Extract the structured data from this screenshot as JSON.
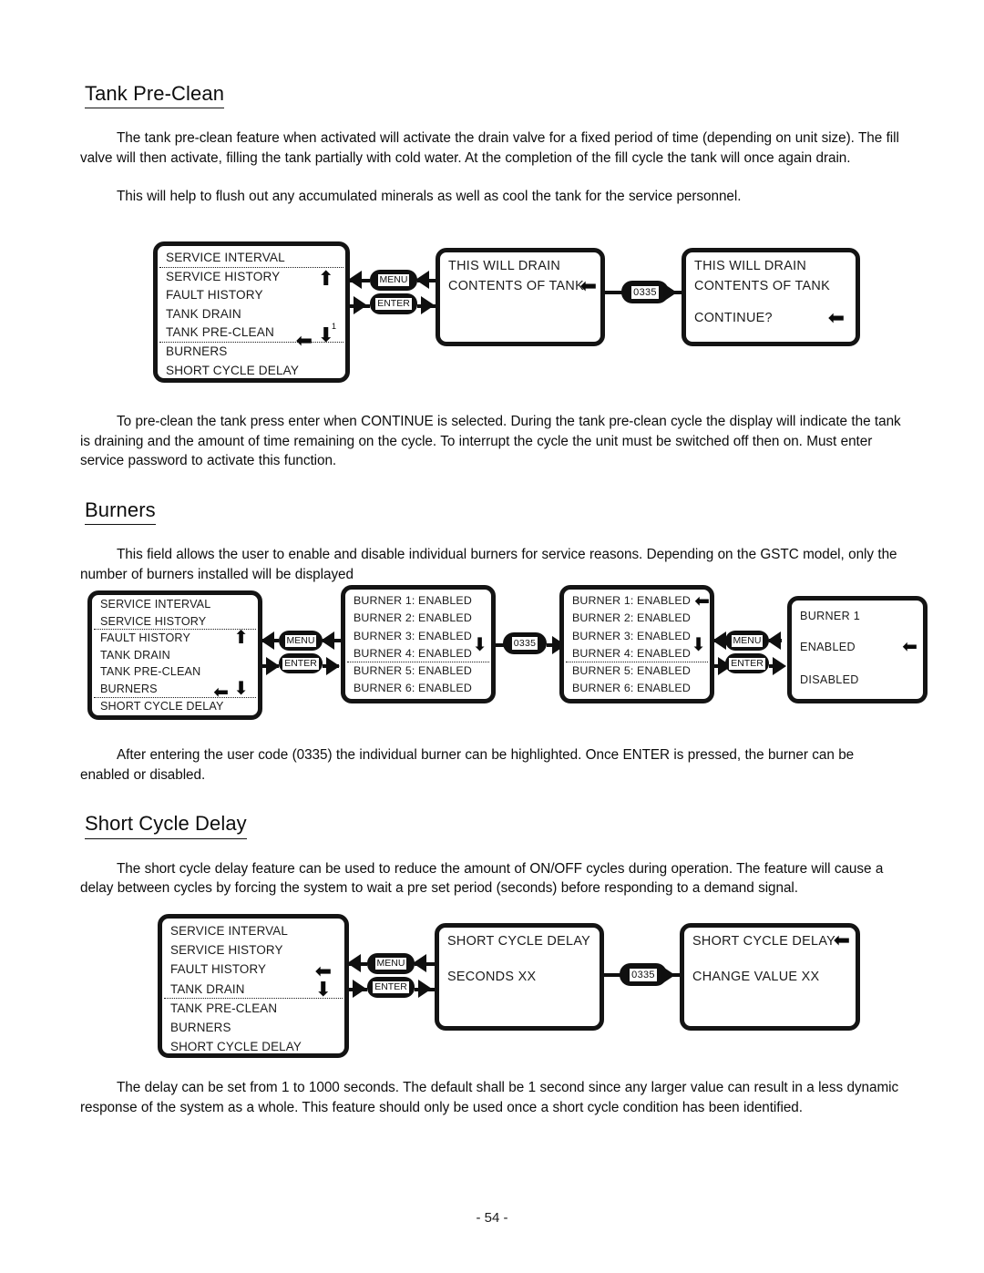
{
  "page": {
    "footer": "- 54 -"
  },
  "sections": [
    {
      "heading": "Tank Pre-Clean",
      "paragraphs": [
        "The tank pre-clean feature when activated will activate the drain valve for a fixed period of time (depending on unit size). The fill valve will then activate, filling the tank partially with cold water. At the completion of the fill cycle the tank will once again drain.",
        "This will help to flush out any accumulated minerals as well as cool the tank for the service personnel."
      ],
      "after_paragraphs": [
        "To pre-clean the tank press enter when CONTINUE is selected. During the tank pre-clean cycle the display will indicate the tank is draining and the amount of time remaining on the cycle. To interrupt the cycle the unit must be switched off then on.  Must enter service password to activate this function."
      ]
    },
    {
      "heading": "Burners",
      "paragraphs": [
        "This field allows the user to enable and disable individual burners for service reasons. Depending on the GSTC model, only the number of burners installed will be displayed"
      ],
      "after_paragraphs": [
        "After entering the user code (0335) the individual burner can be highlighted. Once ENTER is pressed, the burner can be enabled or disabled."
      ]
    },
    {
      "heading": "Short Cycle Delay",
      "paragraphs": [
        "The short cycle delay feature can be used to reduce the amount of ON/OFF cycles during operation. The feature will cause a delay between cycles by forcing the system to wait a pre set period (seconds) before responding to a demand signal."
      ],
      "after_paragraphs": [
        "The delay can be set from 1 to 1000 seconds. The default shall be 1 second since any larger value can result in a less dynamic response of the system as a whole. This feature should only be used once a short cycle condition has been identified."
      ]
    }
  ],
  "keys": {
    "menu": "MENU",
    "enter": "ENTER",
    "code": "0335"
  },
  "diagram1": {
    "screen1_rows": [
      "SERVICE INTERVAL",
      "SERVICE HISTORY",
      "FAULT HISTORY",
      "TANK DRAIN",
      "TANK PRE-CLEAN",
      "BURNERS",
      "SHORT CYCLE DELAY"
    ],
    "screen1_marker": "1",
    "screen2_line1": "THIS WILL DRAIN",
    "screen2_line2": "CONTENTS OF TANK",
    "screen3_line1": "THIS WILL DRAIN",
    "screen3_line2": "CONTENTS OF TANK",
    "screen3_line3": "CONTINUE?"
  },
  "diagram2": {
    "menu_rows": [
      "SERVICE INTERVAL",
      "SERVICE HISTORY",
      "FAULT HISTORY",
      "TANK DRAIN",
      "TANK PRE-CLEAN",
      "BURNERS",
      "SHORT CYCLE DELAY"
    ],
    "burner_rows": [
      "BURNER 1: ENABLED",
      "BURNER 2: ENABLED",
      "BURNER 3: ENABLED",
      "BURNER 4: ENABLED",
      "BURNER 5: ENABLED",
      "BURNER 6: ENABLED"
    ],
    "detail_title": "BURNER 1",
    "detail_enabled": "ENABLED",
    "detail_disabled": "DISABLED"
  },
  "diagram3": {
    "menu_rows": [
      "SERVICE INTERVAL",
      "SERVICE HISTORY",
      "FAULT HISTORY",
      "TANK DRAIN",
      "TANK PRE-CLEAN",
      "BURNERS",
      "SHORT CYCLE DELAY"
    ],
    "screen2_line1": "SHORT CYCLE DELAY",
    "screen2_line2": "SECONDS XX",
    "screen3_line1": "SHORT CYCLE DELAY",
    "screen3_line2": "CHANGE VALUE   XX"
  }
}
